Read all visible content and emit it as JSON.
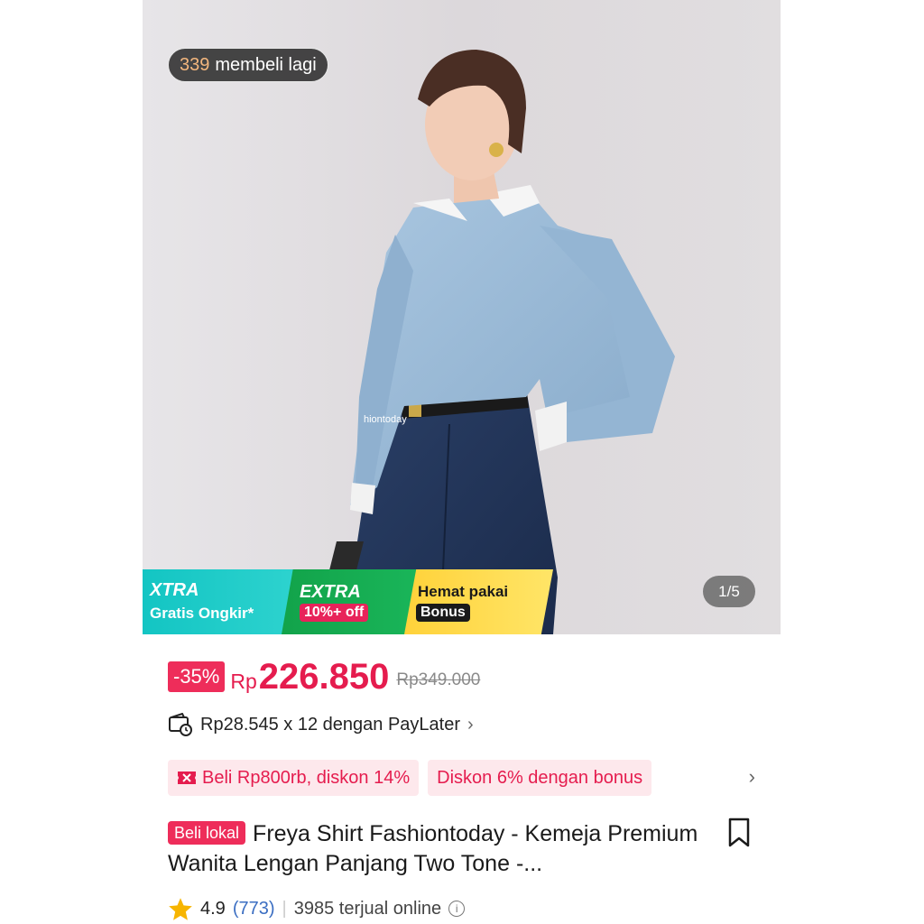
{
  "hero": {
    "buyers_count": "339",
    "buyers_label": "membeli lagi",
    "watermark": "hiontoday",
    "image_counter": "1/5",
    "banner": {
      "xtra_title": "XTRA",
      "xtra_sub": "Gratis Ongkir*",
      "extra_title": "EXTRA",
      "extra_tag": "10%+ off",
      "hemat_title": "Hemat pakai",
      "hemat_tag": "Bonus"
    }
  },
  "price": {
    "discount": "-35%",
    "currency": "Rp",
    "current": "226.850",
    "original": "Rp349.000"
  },
  "paylater": {
    "text": "Rp28.545 x 12 dengan PayLater"
  },
  "promos": [
    {
      "label": "Beli Rp800rb, diskon 14%"
    },
    {
      "label": "Diskon 6% dengan bonus"
    }
  ],
  "product": {
    "badge": "Beli lokal",
    "title": "Freya Shirt Fashiontoday - Kemeja Premium Wanita Lengan Panjang Two Tone -..."
  },
  "rating": {
    "score": "4.9",
    "reviews": "(773)",
    "sold": "3985 terjual online"
  },
  "colors": {
    "accent": "#e51c4e",
    "discount_badge": "#ee2d5a",
    "promo_bg": "#fde8ec",
    "star": "#f7b500"
  }
}
